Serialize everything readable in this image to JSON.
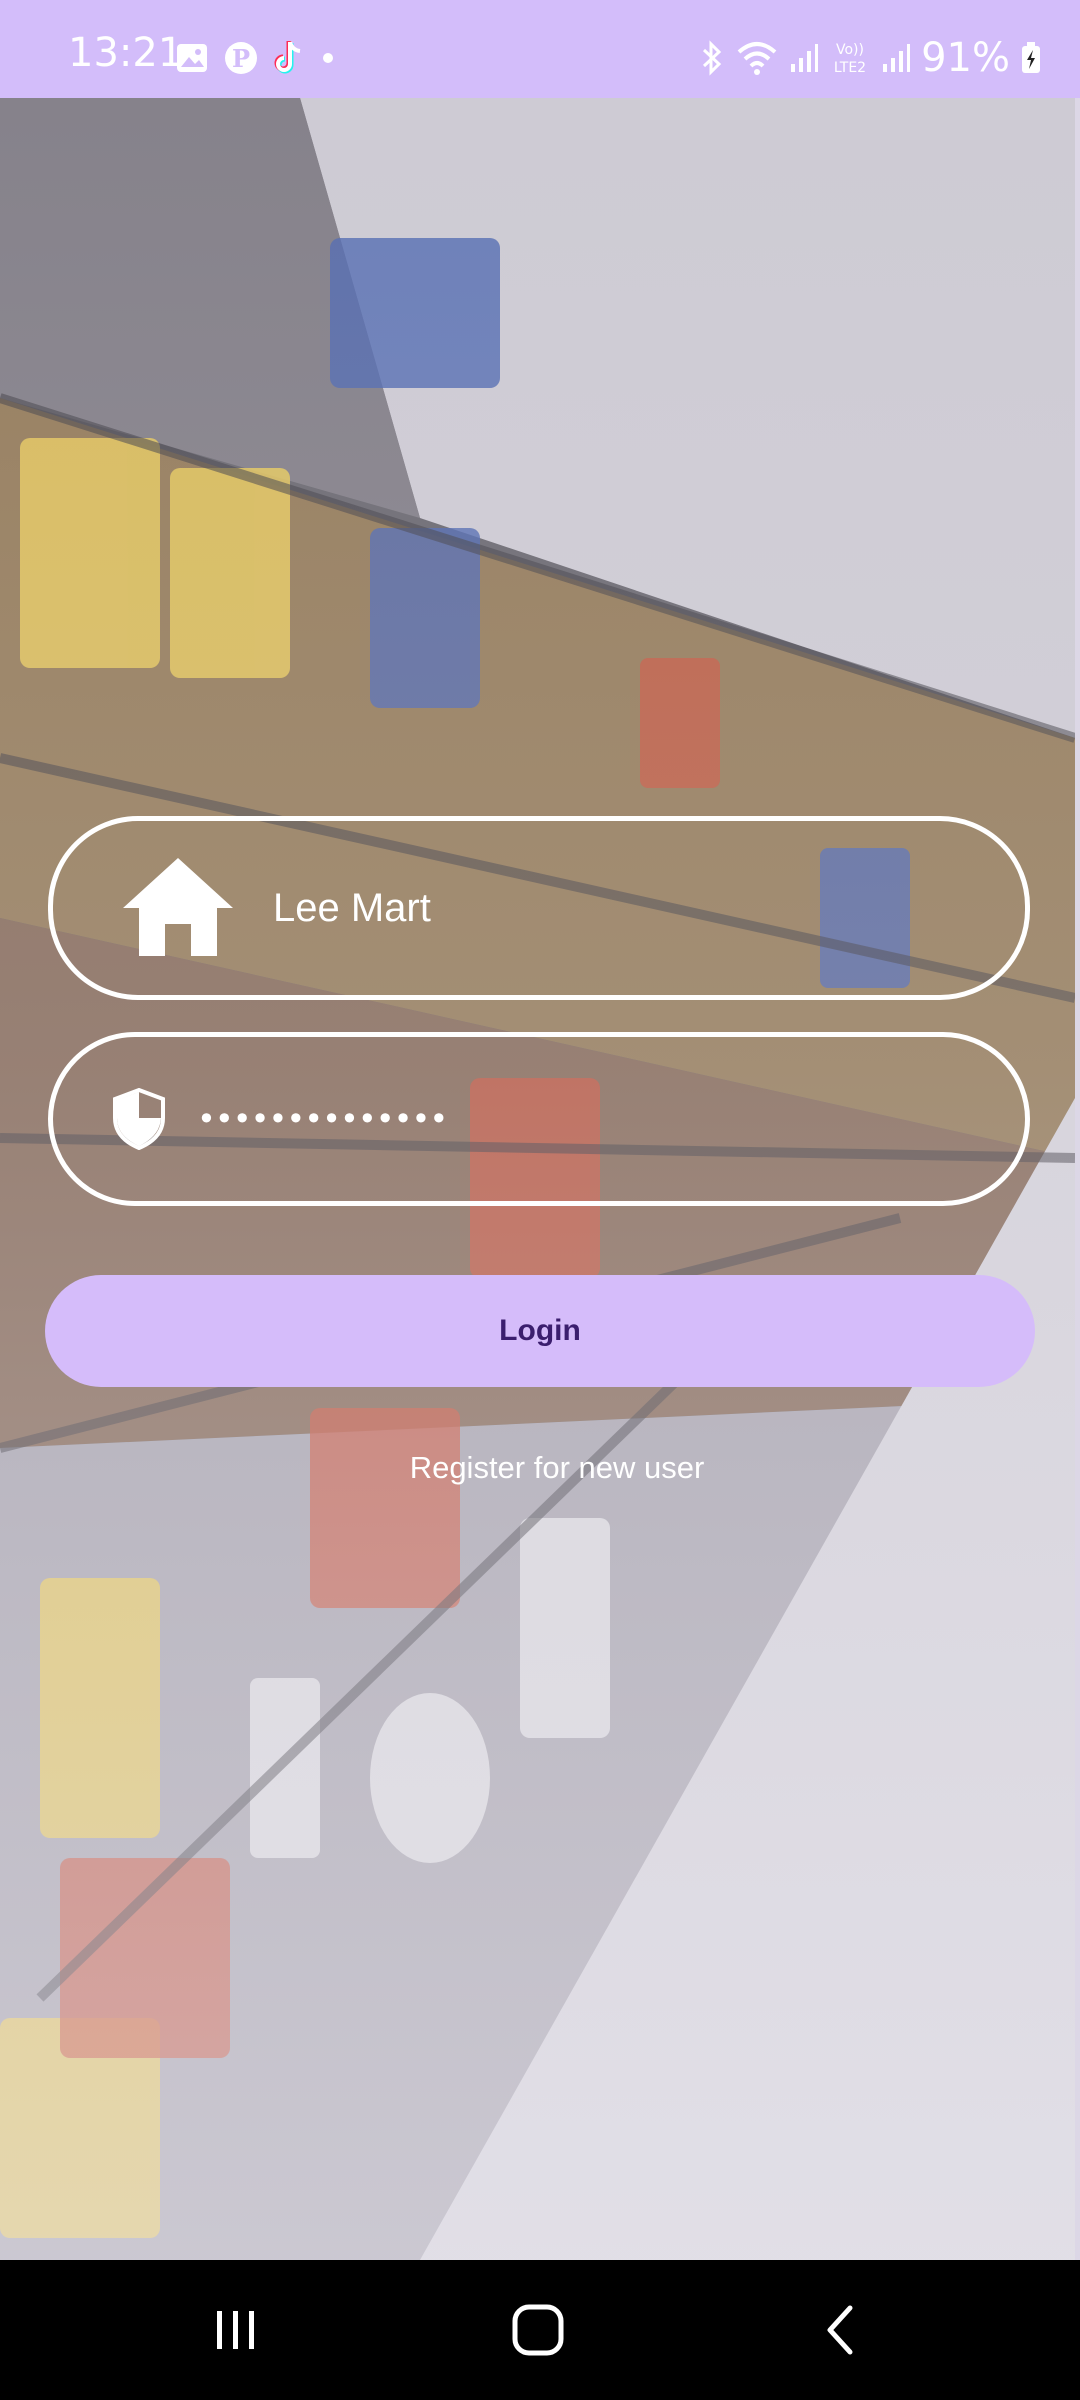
{
  "status_bar": {
    "time": "13:21",
    "battery": "91%",
    "left_icons": [
      "image-icon",
      "pinterest-icon",
      "tiktok-icon",
      "dot-icon"
    ],
    "right_icons": [
      "bluetooth-icon",
      "wifi-icon",
      "signal-icon",
      "volte-icon",
      "signal-icon",
      "battery-charging-icon"
    ]
  },
  "form": {
    "username_value": "Lee Mart",
    "password_value": "••••••••••••••",
    "login_label": "Login",
    "register_label": "Register for new user"
  },
  "nav": {
    "icons": [
      "recents-icon",
      "home-icon",
      "back-icon"
    ]
  },
  "colors": {
    "accent": "#D3BDFA",
    "button_text": "#3B1E6E",
    "nav_bg": "#000000"
  }
}
